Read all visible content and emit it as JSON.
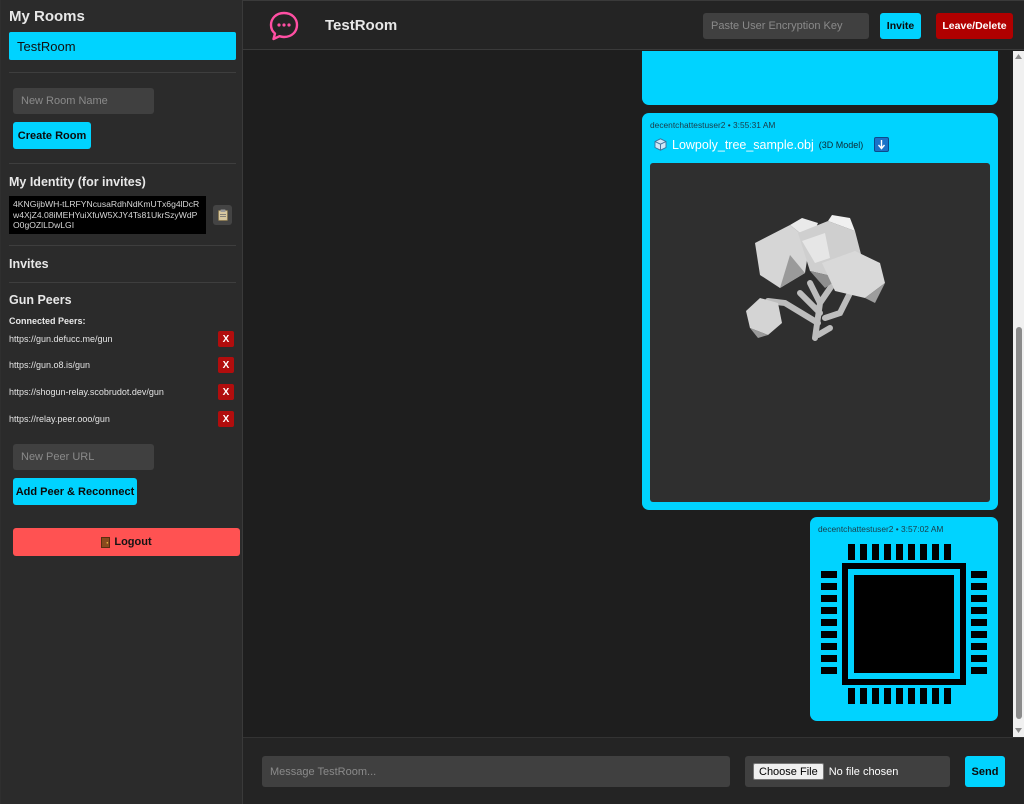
{
  "sidebar": {
    "rooms_title": "My Rooms",
    "rooms": [
      "TestRoom"
    ],
    "new_room_placeholder": "New Room Name",
    "create_room_label": "Create Room",
    "identity_title": "My Identity (for invites)",
    "identity_key": "4KNGijbWH-tLRFYNcusaRdhNdKmUTx6g4lDcRw4XjZ4.08iMEHYuiXfuW5XJY4Ts81UkrSzyWdPO0gOZlLDwLGI",
    "copy_icon": "clipboard-icon",
    "invites_title": "Invites",
    "peers_title": "Gun Peers",
    "connected_label": "Connected Peers:",
    "peers": [
      "https://gun.defucc.me/gun",
      "https://gun.o8.is/gun",
      "https://shogun-relay.scobrudot.dev/gun",
      "https://relay.peer.ooo/gun"
    ],
    "remove_label": "X",
    "new_peer_placeholder": "New Peer URL",
    "add_peer_label": "Add Peer & Reconnect",
    "logout_label": "Logout",
    "logout_icon": "door-icon"
  },
  "header": {
    "room_title": "TestRoom",
    "key_placeholder": "Paste User Encryption Key",
    "invite_label": "Invite",
    "leave_label": "Leave/Delete"
  },
  "messages": [
    {
      "meta": "decentchattestuser2 • 3:55:31 AM",
      "file_name": "Lowpoly_tree_sample.obj",
      "file_type": "(3D Model)",
      "download_icon": "download-arrow-icon"
    },
    {
      "meta": "decentchattestuser2 • 3:57:02 AM",
      "image": "cpu-chip-icon"
    }
  ],
  "composer": {
    "message_placeholder": "Message TestRoom...",
    "choose_file_label": "Choose File",
    "no_file_label": "No file chosen",
    "send_label": "Send"
  },
  "colors": {
    "accent": "#00d3ff",
    "danger": "#b00000",
    "logout": "#ff5252",
    "sidebar_bg": "#2b2b2b",
    "main_bg": "#1e1e1e"
  }
}
